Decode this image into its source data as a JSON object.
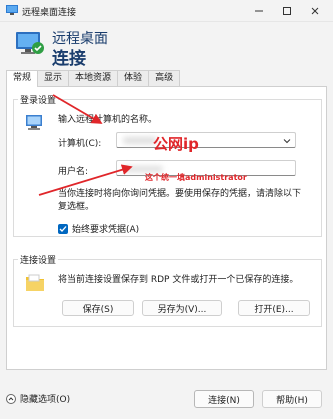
{
  "window": {
    "title": "远程桌面连接"
  },
  "header": {
    "line1": "远程桌面",
    "line2": "连接"
  },
  "tabs": [
    {
      "label": "常规"
    },
    {
      "label": "显示"
    },
    {
      "label": "本地资源"
    },
    {
      "label": "体验"
    },
    {
      "label": "高级"
    }
  ],
  "login": {
    "group_title": "登录设置",
    "hint": "输入远程计算机的名称。",
    "computer_label": "计算机(C):",
    "username_label": "用户名:",
    "note": "当你连接时将向你询问凭据。要使用保存的凭据，请清除以下复选框。",
    "checkbox_label": "始终要求凭据(A)",
    "checkbox_checked": true
  },
  "annotations": {
    "ip": "公网ip",
    "admin": "这个统一填administrator"
  },
  "conn": {
    "group_title": "连接设置",
    "desc": "将当前连接设置保存到 RDP 文件或打开一个已保存的连接。",
    "save_label": "保存(S)",
    "saveas_label": "另存为(V)...",
    "open_label": "打开(E)..."
  },
  "bottom": {
    "hide_label": "隐藏选项(O)",
    "connect_label": "连接(N)",
    "help_label": "帮助(H)"
  },
  "colors": {
    "accent": "#1a3d6d",
    "annotation": "#e0262a"
  }
}
